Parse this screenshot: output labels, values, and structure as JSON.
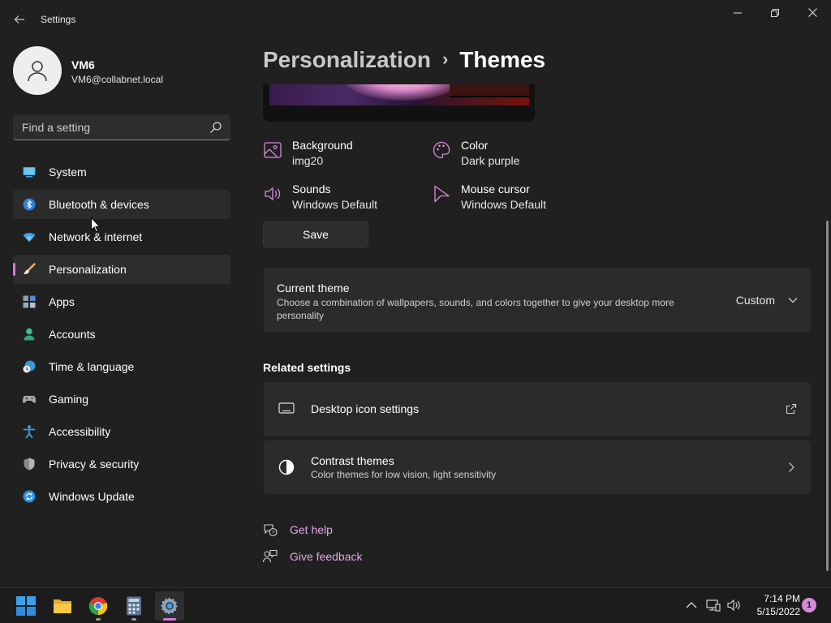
{
  "window": {
    "title": "Settings",
    "back_icon": "back-arrow-icon",
    "controls": {
      "minimize": "—",
      "maximize": "❐",
      "close": "✕"
    }
  },
  "profile": {
    "name": "VM6",
    "email": "VM6@collabnet.local"
  },
  "search": {
    "placeholder": "Find a setting"
  },
  "sidebar": {
    "items": [
      {
        "label": "System",
        "icon": "system-icon"
      },
      {
        "label": "Bluetooth & devices",
        "icon": "bluetooth-icon"
      },
      {
        "label": "Network & internet",
        "icon": "wifi-icon"
      },
      {
        "label": "Personalization",
        "icon": "brush-icon"
      },
      {
        "label": "Apps",
        "icon": "apps-icon"
      },
      {
        "label": "Accounts",
        "icon": "accounts-icon"
      },
      {
        "label": "Time & language",
        "icon": "time-language-icon"
      },
      {
        "label": "Gaming",
        "icon": "gamepad-icon"
      },
      {
        "label": "Accessibility",
        "icon": "accessibility-icon"
      },
      {
        "label": "Privacy & security",
        "icon": "shield-icon"
      },
      {
        "label": "Windows Update",
        "icon": "windows-update-icon"
      }
    ],
    "active_index": 3
  },
  "breadcrumb": {
    "parent": "Personalization",
    "separator": "›",
    "current": "Themes"
  },
  "theme_properties": {
    "background": {
      "name": "Background",
      "value": "img20"
    },
    "color": {
      "name": "Color",
      "value": "Dark purple"
    },
    "sounds": {
      "name": "Sounds",
      "value": "Windows Default"
    },
    "mouse_cursor": {
      "name": "Mouse cursor",
      "value": "Windows Default"
    }
  },
  "save_label": "Save",
  "current_theme": {
    "title": "Current theme",
    "description": "Choose a combination of wallpapers, sounds, and colors together to give your desktop more personality",
    "selected": "Custom"
  },
  "related": {
    "title": "Related settings",
    "desktop_icons": {
      "title": "Desktop icon settings"
    },
    "contrast": {
      "title": "Contrast themes",
      "subtitle": "Color themes for low vision, light sensitivity"
    }
  },
  "help": {
    "get_help": "Get help",
    "give_feedback": "Give feedback"
  },
  "taskbar": {
    "apps": [
      "start-icon",
      "file-explorer-icon",
      "chrome-icon",
      "calculator-icon",
      "settings-icon"
    ],
    "time": "7:14 PM",
    "date": "5/15/2022",
    "notification_count": "1"
  },
  "colors": {
    "accent": "#d479d8",
    "link": "#e1a6e6",
    "background": "#202020",
    "card": "#2b2b2b"
  }
}
